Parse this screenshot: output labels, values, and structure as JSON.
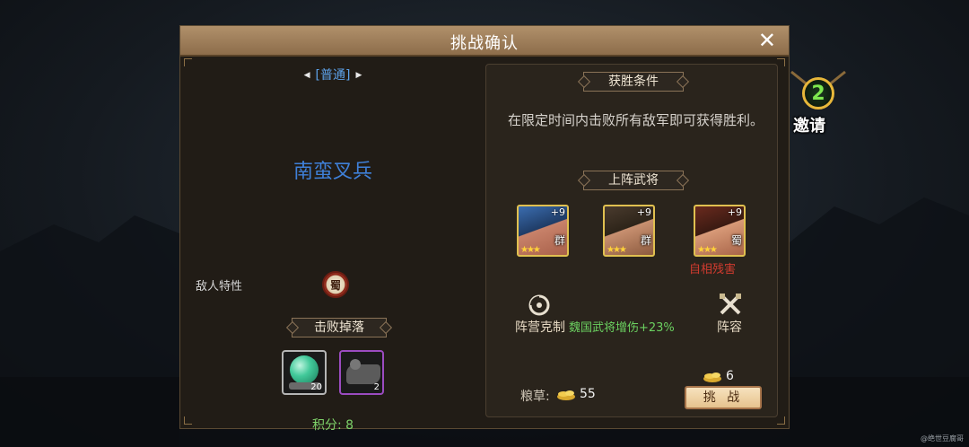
{
  "dialog": {
    "title": "挑战确认",
    "close_symbol": "✕"
  },
  "left": {
    "mode": "[普通]",
    "enemy_name": "南蛮叉兵",
    "trait_label": "敌人特性",
    "trait_badge": "蜀",
    "drops_title": "击败掉落",
    "drops": [
      {
        "icon": "jade-orb-icon",
        "count": "20",
        "quality_color": "#b5b5b5"
      },
      {
        "icon": "mount-icon",
        "count": "2",
        "quality_color": "#9b4bc0"
      }
    ],
    "score": "积分: 8"
  },
  "right": {
    "victory_title": "获胜条件",
    "victory_text": "在限定时间内击败所有敌军即可获得胜利。",
    "generals_title": "上阵武将",
    "generals": [
      {
        "level": "+9",
        "faction": "群",
        "stars": "★★★"
      },
      {
        "level": "+9",
        "faction": "群",
        "stars": "★★★"
      },
      {
        "level": "+9",
        "faction": "蜀",
        "stars": "★★★",
        "tag": "自相残害"
      }
    ],
    "counter_label": "阵营克制",
    "counter_bonus": "魏国武将增伤+23%",
    "lineup_label": "阵容",
    "food_label": "粮草:",
    "food_value": "55",
    "cost_value": "6",
    "challenge_label": "挑 战"
  },
  "invite": {
    "count": "2",
    "label": "邀请"
  },
  "watermark": "@绝世豆腐哥"
}
